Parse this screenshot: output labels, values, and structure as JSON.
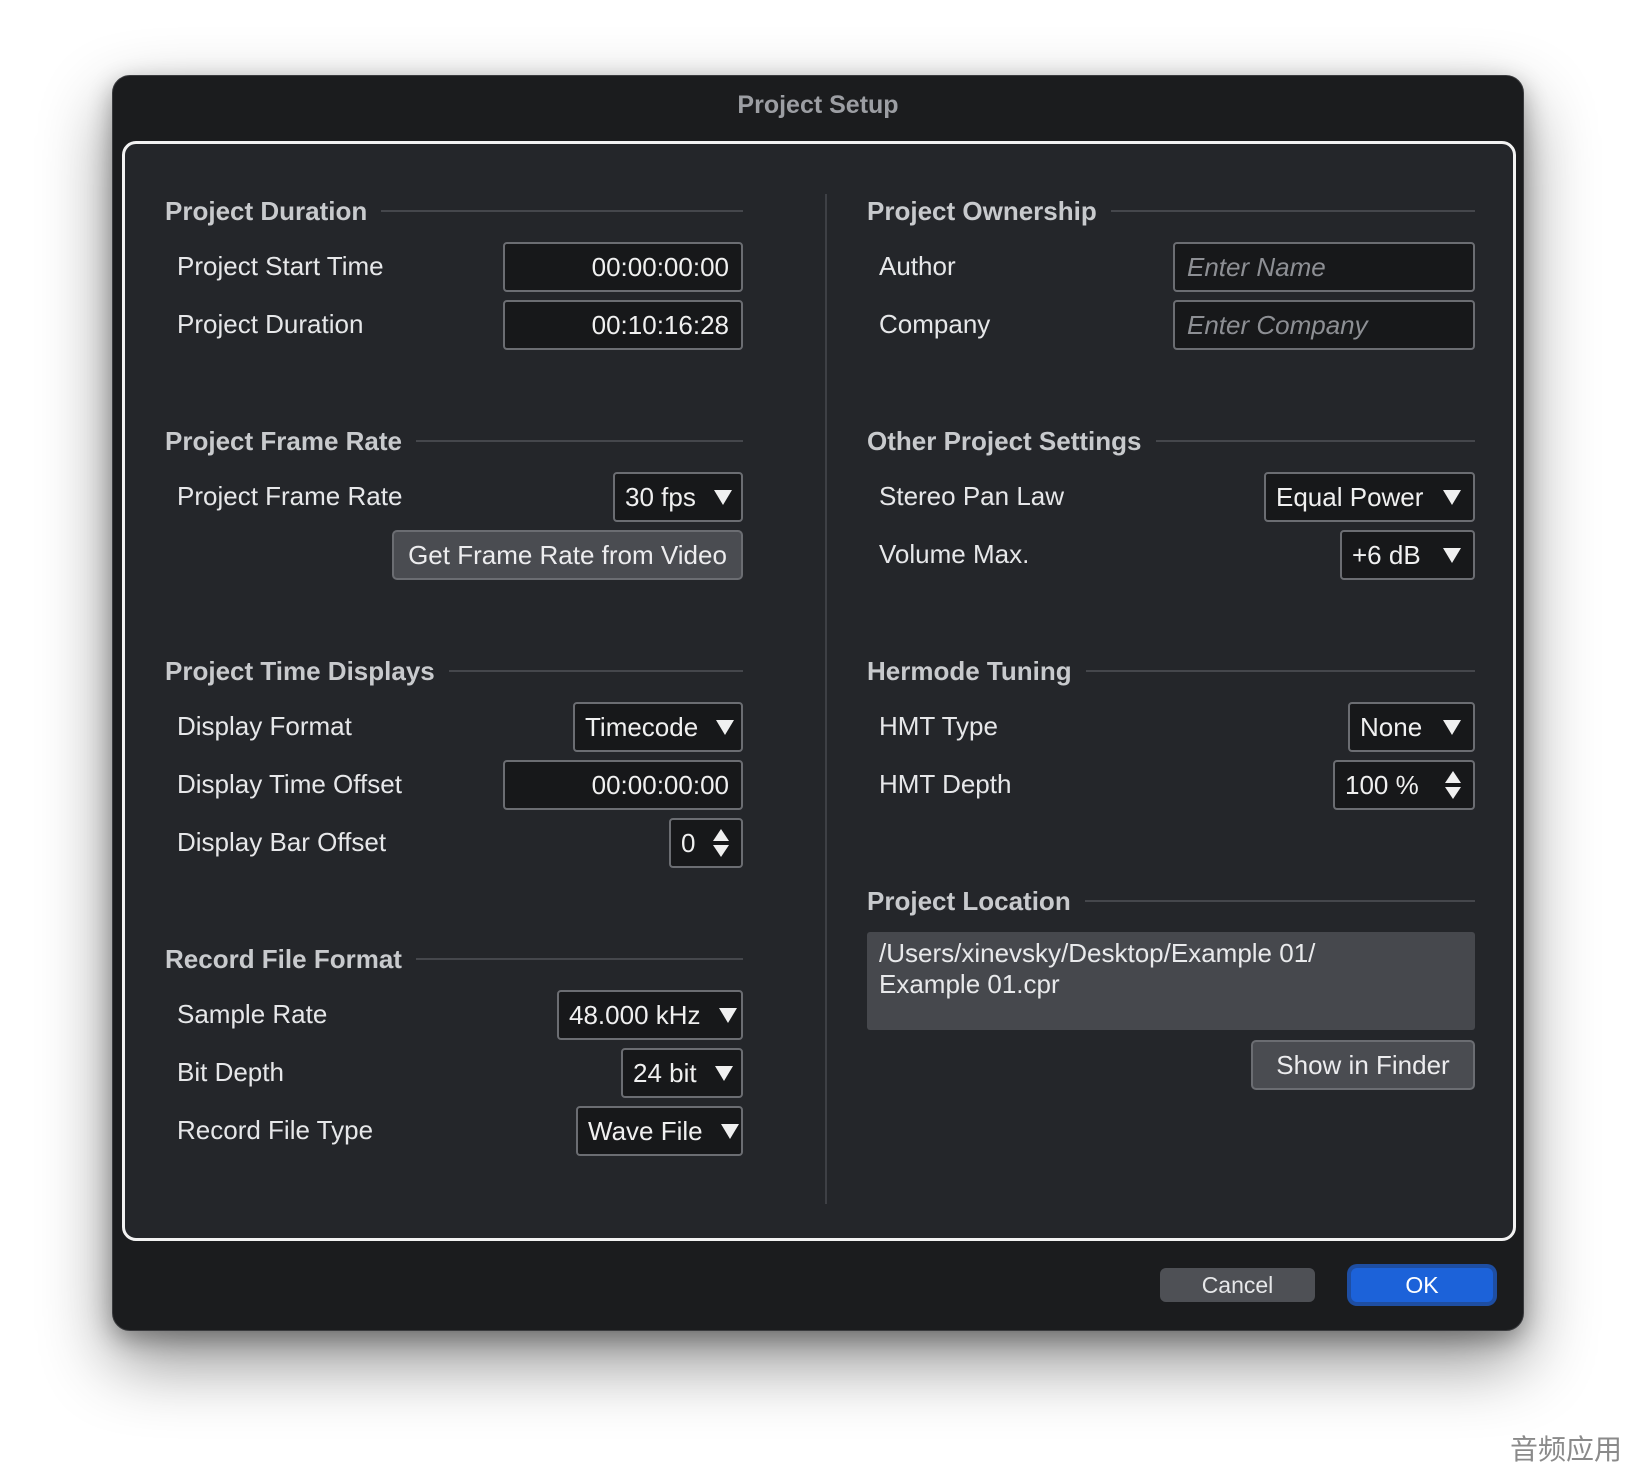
{
  "window": {
    "title": "Project Setup"
  },
  "left": {
    "duration": {
      "title": "Project Duration",
      "start_label": "Project Start Time",
      "start_value": "00:00:00:00",
      "duration_label": "Project Duration",
      "duration_value": "00:10:16:28"
    },
    "frame_rate": {
      "title": "Project Frame Rate",
      "label": "Project Frame Rate",
      "value": "30 fps",
      "button": "Get Frame Rate from Video"
    },
    "time_displays": {
      "title": "Project Time Displays",
      "format_label": "Display Format",
      "format_value": "Timecode",
      "offset_label": "Display Time Offset",
      "offset_value": "00:00:00:00",
      "bar_offset_label": "Display Bar Offset",
      "bar_offset_value": "0"
    },
    "record": {
      "title": "Record File Format",
      "sample_rate_label": "Sample Rate",
      "sample_rate_value": "48.000 kHz",
      "bit_depth_label": "Bit Depth",
      "bit_depth_value": "24 bit",
      "file_type_label": "Record File Type",
      "file_type_value": "Wave File"
    }
  },
  "right": {
    "ownership": {
      "title": "Project Ownership",
      "author_label": "Author",
      "author_placeholder": "Enter Name",
      "company_label": "Company",
      "company_placeholder": "Enter Company"
    },
    "other": {
      "title": "Other Project Settings",
      "pan_label": "Stereo Pan Law",
      "pan_value": "Equal Power",
      "volume_label": "Volume Max.",
      "volume_value": "+6 dB"
    },
    "hermode": {
      "title": "Hermode Tuning",
      "type_label": "HMT Type",
      "type_value": "None",
      "depth_label": "HMT Depth",
      "depth_value": "100 %"
    },
    "location": {
      "title": "Project Location",
      "path_line1": "/Users/xinevsky/Desktop/Example 01/",
      "path_line2": "Example 01.cpr",
      "button": "Show in Finder"
    }
  },
  "footer": {
    "cancel": "Cancel",
    "ok": "OK"
  },
  "watermark": "音频应用"
}
